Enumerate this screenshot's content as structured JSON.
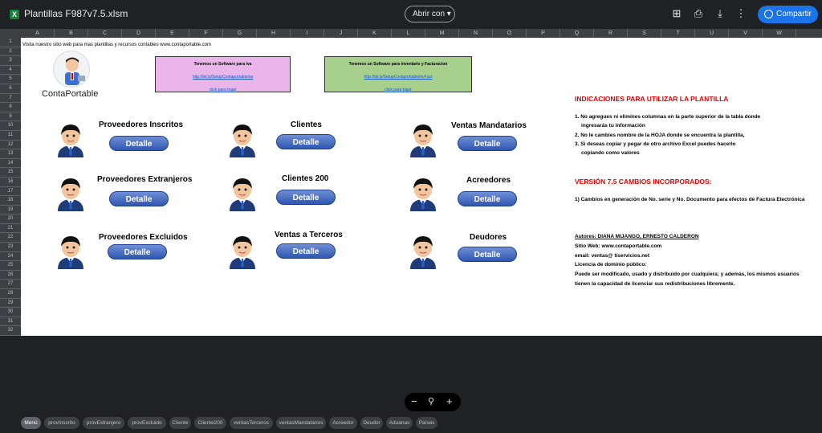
{
  "window": {
    "title": "Plantillas F987v7.5.xlsm",
    "open_with": "Abrir con",
    "share": "Compartir"
  },
  "columns": [
    "A",
    "B",
    "C",
    "D",
    "E",
    "F",
    "G",
    "H",
    "I",
    "J",
    "K",
    "L",
    "M",
    "N",
    "O",
    "P",
    "Q",
    "R",
    "S",
    "T",
    "U",
    "V",
    "W"
  ],
  "rows": [
    "1",
    "2",
    "3",
    "4",
    "5",
    "6",
    "7",
    "8",
    "9",
    "10",
    "11",
    "12",
    "13",
    "14",
    "15",
    "16",
    "17",
    "18",
    "19",
    "20",
    "21",
    "22",
    "23",
    "24",
    "25",
    "26",
    "27",
    "28",
    "29",
    "30",
    "31",
    "32"
  ],
  "sheet": {
    "top_text": "Visita nuestro sitio web para mas plantillas y recursos contables www.contaportable.com",
    "logo_text": "ContaPortable",
    "promo_iva": {
      "title": "Tenemos un Software para iva",
      "link": "http://bit.ly/SetupContaportableIva",
      "click": "click para bajar"
    },
    "promo_inv": {
      "title": "Tenemos un Software para inventario y Facturacion",
      "link": "http://bit.ly/SetupContaportableInvFact",
      "click": "click para bajar"
    },
    "cards": [
      {
        "title": "Proveedores Inscritos",
        "button": "Detalle"
      },
      {
        "title": "Clientes",
        "button": "Detalle"
      },
      {
        "title": "Ventas Mandatarios",
        "button": "Detalle"
      },
      {
        "title": "Proveedores Extranjeros",
        "button": "Detalle"
      },
      {
        "title": "Clientes 200",
        "button": "Detalle"
      },
      {
        "title": "Acreedores",
        "button": "Detalle"
      },
      {
        "title": "Proveedores Excluidos",
        "button": "Detalle"
      },
      {
        "title": "Ventas a Terceros",
        "button": "Detalle"
      },
      {
        "title": "Deudores",
        "button": "Detalle"
      }
    ],
    "instructions": {
      "heading": "INDICACIONES PARA UTILIZAR LA PLANTILLA",
      "line1": "1. No agregues ni elimines columnas en la parte superior de la tabla donde",
      "line1b": "ingresarás tu información",
      "line2": "2. No le cambies nombre de la HOJA donde se encuentra la plantilla,",
      "line3": "3. Si deseas copiar y pegar de otro archivo Excel puedes hacerlo",
      "line3b": "copiando como valores"
    },
    "version": {
      "heading": "VERSIÓN 7.5 CAMBIOS INCORPORADOS:",
      "line1": "1) Cambios en generación de No. serie y No. Documento para efectos de Factura Electrónica"
    },
    "authors": {
      "heading": "Autores: DIANA MIJANGO, ERNESTO CALDERON",
      "web": "Sitio Web: www.contaportable.com",
      "email": "email: ventas@ tiservicios.net",
      "license": "Licencia de dominio público:",
      "license1": "Puede ser modificado, usado y distribuido por cualquiera; y además, los mismos usuarios",
      "license2": "tienen la capacidad de licenciar sus redistribuciones libremente."
    }
  },
  "tabs": [
    "Menú",
    "provInscrito",
    "provExtranjero",
    "provExcluido",
    "Cliente",
    "Cliente200",
    "ventasTerceros",
    "ventasMandatarios",
    "Acreedor",
    "Deudor",
    "Aduanas",
    "Países"
  ]
}
